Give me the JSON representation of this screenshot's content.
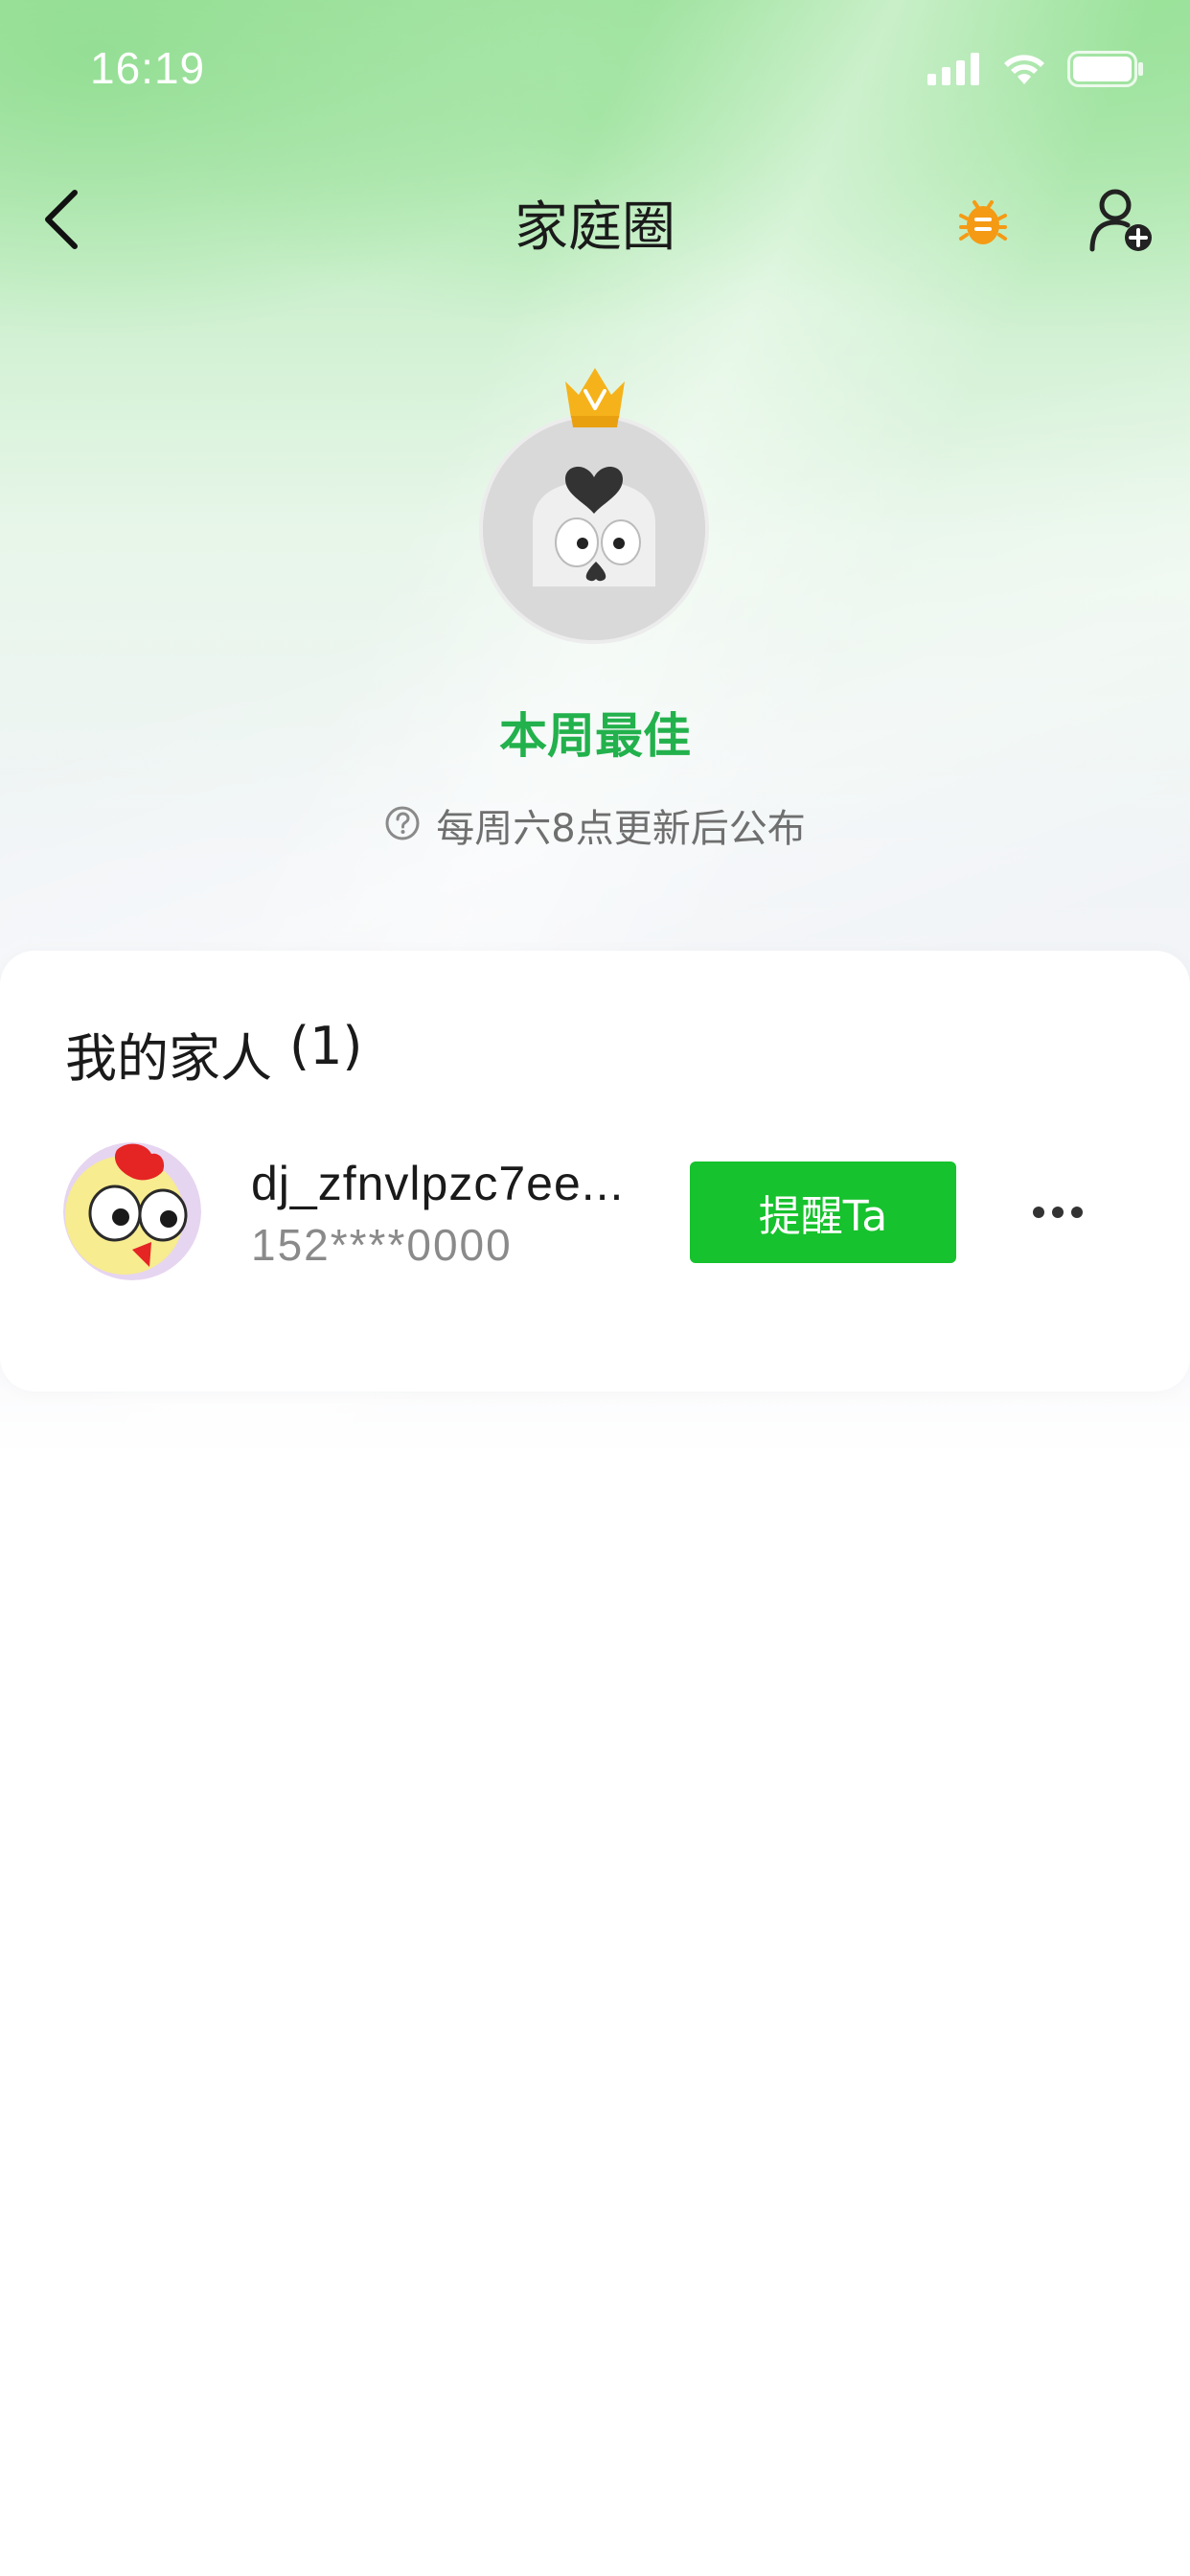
{
  "status_bar": {
    "time": "16:19",
    "icons": [
      "signal-icon",
      "wifi-icon",
      "battery-icon"
    ]
  },
  "nav": {
    "title": "家庭圈",
    "back_icon": "chevron-left-icon",
    "debug_icon": "bug-icon",
    "add_member_icon": "add-user-icon"
  },
  "best_of_week": {
    "title": "本周最佳",
    "hint": "每周六8点更新后公布",
    "hint_icon": "question-circle-icon",
    "crown_icon": "crown-icon"
  },
  "family": {
    "heading": "我的家人",
    "count": "(1)",
    "members": [
      {
        "name": "dj_zfnvlpzc7ee...",
        "phone": "152****0000",
        "remind_label": "提醒Ta",
        "more_icon": "more-horizontal-icon"
      }
    ]
  },
  "colors": {
    "accent_green": "#16c22d",
    "best_title_green": "#22b14c",
    "bug_orange": "#f59a14",
    "crown_gold": "#f5b21a"
  }
}
